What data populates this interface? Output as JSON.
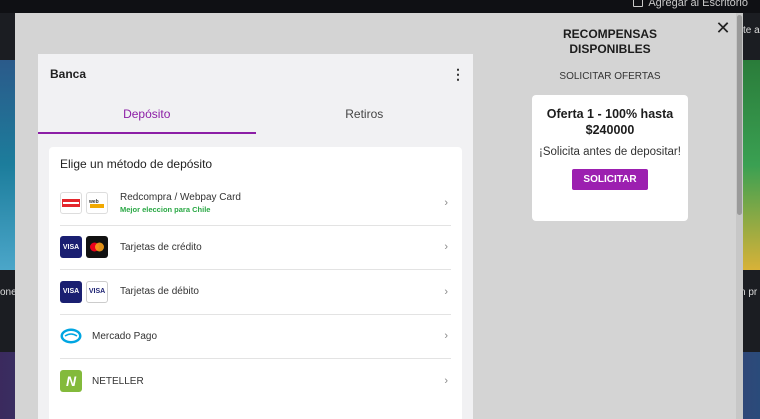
{
  "background": {
    "top_action": "Agregar al Escritorio",
    "left_text": "one",
    "right_text": "n pr",
    "right_chat": "te a"
  },
  "modal": {
    "close_glyph": "✕",
    "banca": {
      "title": "Banca",
      "menu_glyph": "⋮",
      "tabs": [
        {
          "label": "Depósito",
          "active": true
        },
        {
          "label": "Retiros",
          "active": false
        }
      ],
      "methods_heading": "Elige un método de depósito",
      "methods": [
        {
          "name": "Redcompra / Webpay Card",
          "sub": "Mejor eleccion para Chile",
          "logos": [
            "REDCOMPRA",
            "webpay"
          ]
        },
        {
          "name": "Tarjetas de crédito",
          "sub": "",
          "logos": [
            "VISA",
            "mastercard"
          ]
        },
        {
          "name": "Tarjetas de débito",
          "sub": "",
          "logos": [
            "VISA",
            "VISA"
          ]
        },
        {
          "name": "Mercado Pago",
          "sub": "",
          "logos": [
            "mercadopago"
          ]
        },
        {
          "name": "NETELLER",
          "sub": "",
          "logos": [
            "N"
          ]
        }
      ],
      "chevron": "›"
    },
    "rewards": {
      "title": "RECOMPENSAS DISPONIBLES",
      "request_offers": "SOLICITAR OFERTAS",
      "offer": {
        "title": "Oferta 1 - 100% hasta $240000",
        "note": "¡Solicita antes de depositar!",
        "button": "SOLICITAR"
      }
    }
  },
  "colors": {
    "accent": "#8c1ea6",
    "button": "#9c1fb0",
    "recommended": "#2aa845"
  }
}
